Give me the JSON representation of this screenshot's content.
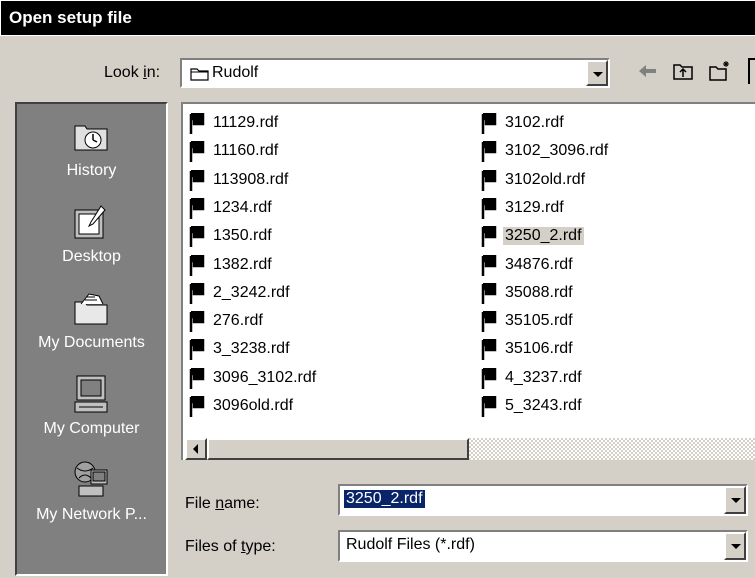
{
  "window": {
    "title": "Open setup file"
  },
  "look_in": {
    "label_pre": "Look ",
    "label_accel": "i",
    "label_post": "n:",
    "value": "Rudolf",
    "folder_icon": "folder-icon"
  },
  "toolbar": {
    "icons": [
      "back-arrow-icon",
      "up-folder-icon",
      "new-folder-icon"
    ]
  },
  "places": [
    {
      "label": "History",
      "icon": "history-icon"
    },
    {
      "label": "Desktop",
      "icon": "desktop-icon"
    },
    {
      "label": "My Documents",
      "icon": "my-documents-icon"
    },
    {
      "label": "My Computer",
      "icon": "my-computer-icon"
    },
    {
      "label": "My Network P...",
      "icon": "network-places-icon"
    }
  ],
  "files": {
    "column1": [
      "11129.rdf",
      "11160.rdf",
      "113908.rdf",
      "1234.rdf",
      "1350.rdf",
      "1382.rdf",
      "2_3242.rdf",
      "276.rdf",
      "3_3238.rdf",
      "3096_3102.rdf",
      "3096old.rdf"
    ],
    "column2": [
      "3102.rdf",
      "3102_3096.rdf",
      "3102old.rdf",
      "3129.rdf",
      "3250_2.rdf",
      "34876.rdf",
      "35088.rdf",
      "35105.rdf",
      "35106.rdf",
      "4_3237.rdf",
      "5_3243.rdf"
    ],
    "selected": "3250_2.rdf"
  },
  "file_name": {
    "label_pre": "File ",
    "label_accel": "n",
    "label_post": "ame:",
    "value": "3250_2.rdf"
  },
  "file_type": {
    "label_pre": "Files of ",
    "label_accel": "t",
    "label_post": "ype:",
    "value": "Rudolf Files (*.rdf)"
  },
  "colors": {
    "title_bg": "#000000",
    "dialog_bg": "#d4d0c8",
    "places_bg": "#808080",
    "selection": "#0a246a"
  }
}
